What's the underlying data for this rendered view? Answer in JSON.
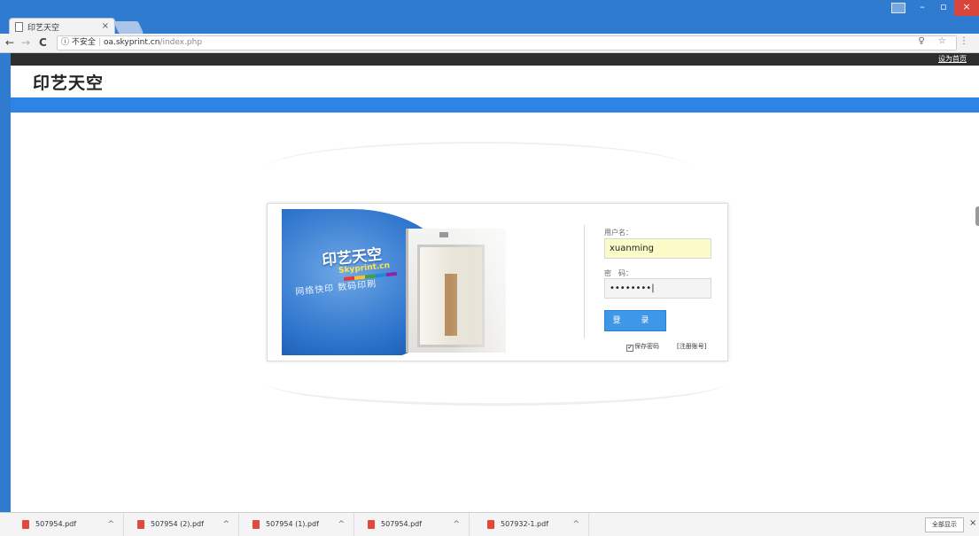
{
  "browser": {
    "tab_title": "印艺天空",
    "tab_close": "×",
    "url_security": "不安全",
    "url_host": "oa.skyprint.cn",
    "url_path": "/index.php",
    "nav_back": "←",
    "nav_forward": "→",
    "nav_reload": "C",
    "info_icon": "ⓘ",
    "right_icons": "♀ ☆ ⋮",
    "win_minimize": "–",
    "win_maximize": "▫",
    "win_close": "×"
  },
  "page": {
    "top_link": "设为首页",
    "site_title": "印艺天空"
  },
  "login": {
    "photo_brand": "印艺天空",
    "photo_site": "Skyprint.cn",
    "photo_slogan": "网络快印 数码印刷",
    "username_label": "用户名：",
    "username_value": "xuanming",
    "password_label": "密　码：",
    "password_value": "••••••••|",
    "login_button": "登 录",
    "remember_checked": "✔",
    "remember_label": "保存密码",
    "register_link": "[注册账号]"
  },
  "downloads": {
    "items": [
      {
        "name": "507954.pdf"
      },
      {
        "name": "507954 (2).pdf"
      },
      {
        "name": "507954 (1).pdf"
      },
      {
        "name": "507954.pdf"
      },
      {
        "name": "507932-1.pdf"
      }
    ],
    "chevron": "^",
    "show_all": "全部显示",
    "close": "×"
  },
  "colors": {
    "chrome_blue": "#2f7bd0",
    "nav_bar_blue": "#2e84e6",
    "top_bar_dark": "#2e2e2e",
    "login_button": "#3f97e8",
    "username_autofill": "#fbfbc8"
  }
}
